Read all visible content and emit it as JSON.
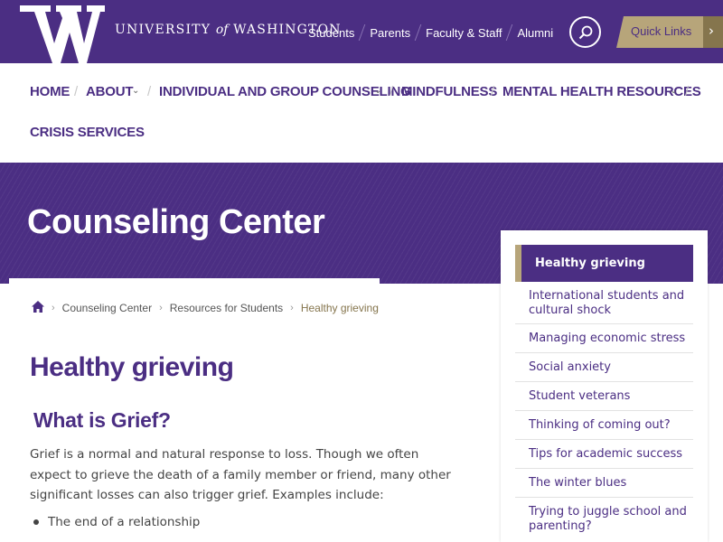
{
  "header": {
    "logo_letter": "W",
    "wordmark": {
      "part1": "UNIVERSITY",
      "of": "of",
      "part2": "WASHINGTON"
    },
    "links": [
      "Students",
      "Parents",
      "Faculty & Staff",
      "Alumni"
    ],
    "search_icon": "search-icon",
    "quick_links_label": "Quick Links",
    "quick_links_arrow": "›"
  },
  "nav": {
    "items": [
      {
        "label": "HOME"
      },
      {
        "label": "ABOUT"
      },
      {
        "label": "INDIVIDUAL AND GROUP COUNSELING"
      },
      {
        "label": "MINDFULNESS"
      },
      {
        "label": "MENTAL HEALTH RESOURCES"
      },
      {
        "label": "CRISIS SERVICES"
      }
    ],
    "separator": "/",
    "caret": "⌄"
  },
  "hero": {
    "title": "Counseling Center"
  },
  "breadcrumb": {
    "home_icon": "home-icon",
    "separator": "›",
    "items": [
      "Counseling Center",
      "Resources for Students",
      "Healthy grieving"
    ]
  },
  "article": {
    "title": "Healthy grieving",
    "section_title": "What is Grief?",
    "paragraph": "Grief is a normal and natural response to loss. Though we often expect to grieve the death of a family member or friend, many other significant losses can also trigger grief. Examples include:",
    "bullets": [
      "The end of a relationship"
    ]
  },
  "sidebar": {
    "active": "Healthy grieving",
    "items": [
      {
        "label": "International students and cultural shock"
      },
      {
        "label": "Managing economic stress"
      },
      {
        "label": "Social anxiety"
      },
      {
        "label": "Student veterans"
      },
      {
        "label": "Thinking of coming out?"
      },
      {
        "label": "Tips for academic success"
      },
      {
        "label": "The winter blues"
      },
      {
        "label": "Trying to juggle school and parenting?"
      }
    ]
  },
  "colors": {
    "purple": "#4b2e83",
    "gold": "#b7a57a",
    "dark_gold": "#85754d"
  }
}
